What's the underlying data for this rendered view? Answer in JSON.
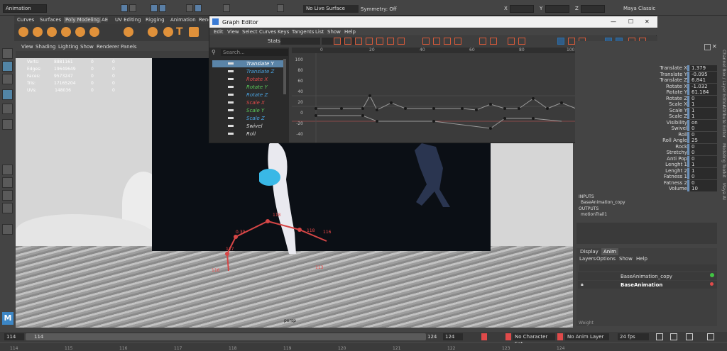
{
  "topbar": {
    "mode_select": "Animation",
    "live_surface": "No Live Surface",
    "symmetry": "Symmetry: Off",
    "axes": [
      "X",
      "Y",
      "Z"
    ],
    "workspace": "Maya Classic"
  },
  "shelf": {
    "tabs": [
      "Curves",
      "Surfaces",
      "Poly Modeling",
      "AE",
      "UV Editing",
      "Rigging",
      "Animation",
      "Rend"
    ],
    "active_tab": "Poly Modeling"
  },
  "viewport": {
    "menu": [
      "View",
      "Shading",
      "Lighting",
      "Show",
      "Renderer",
      "Panels"
    ],
    "hud": [
      {
        "label": "Verts:",
        "v1": "8881161",
        "v2": "0",
        "v3": "0"
      },
      {
        "label": "Edges:",
        "v1": "19649649",
        "v2": "0",
        "v3": "0"
      },
      {
        "label": "Faces:",
        "v1": "9573247",
        "v2": "0",
        "v3": "0"
      },
      {
        "label": "Tris:",
        "v1": "17165204",
        "v2": "0",
        "v3": "0"
      },
      {
        "label": "UVs:",
        "v1": "148036",
        "v2": "0",
        "v3": "0"
      }
    ],
    "camera_label": "persp",
    "rig_labels": [
      "0.39",
      "118",
      "117",
      "116",
      "118",
      "113",
      "116"
    ]
  },
  "graph_editor": {
    "title": "Graph Editor",
    "window_controls": [
      "—",
      "☐",
      "✕"
    ],
    "menu": [
      "Edit",
      "View",
      "Select",
      "Curves",
      "Keys",
      "Tangents",
      "List",
      "Show",
      "Help"
    ],
    "stats_label": "Stats",
    "search_placeholder": "Search...",
    "outliner": [
      {
        "label": "Translate Y",
        "color": "#ffffff",
        "selected": true
      },
      {
        "label": "Translate Z",
        "color": "#4aa3e0",
        "selected": false
      },
      {
        "label": "Rotate X",
        "color": "#e04a4a",
        "selected": false
      },
      {
        "label": "Rotate Y",
        "color": "#5ac95a",
        "selected": false
      },
      {
        "label": "Rotate Z",
        "color": "#4aa3e0",
        "selected": false
      },
      {
        "label": "Scale X",
        "color": "#e04a4a",
        "selected": false
      },
      {
        "label": "Scale Y",
        "color": "#5ac95a",
        "selected": false
      },
      {
        "label": "Scale Z",
        "color": "#4aa3e0",
        "selected": false
      },
      {
        "label": "Swivel",
        "color": "#dddddd",
        "selected": false
      },
      {
        "label": "Roll",
        "color": "#dddddd",
        "selected": false
      }
    ],
    "ruler": [
      "0",
      "20",
      "40",
      "60",
      "80",
      "100"
    ],
    "frame_markers": [
      "114",
      "122",
      "124"
    ],
    "y_ticks": [
      "100",
      "80",
      "60",
      "40",
      "20",
      "0",
      "-20",
      "-40"
    ]
  },
  "channel_box": {
    "channels": [
      {
        "label": "Translate X",
        "value": "1.379"
      },
      {
        "label": "Translate Y",
        "value": "-0.095"
      },
      {
        "label": "Translate Z",
        "value": "6.841"
      },
      {
        "label": "Rotate X",
        "value": "-1.032"
      },
      {
        "label": "Rotate Y",
        "value": "61.184"
      },
      {
        "label": "Rotate Z",
        "value": "0"
      },
      {
        "label": "Scale X",
        "value": "1"
      },
      {
        "label": "Scale Y",
        "value": "1"
      },
      {
        "label": "Scale Z",
        "value": "1"
      },
      {
        "label": "Visibility",
        "value": "on"
      },
      {
        "label": "Swivel",
        "value": "0"
      },
      {
        "label": "Roll",
        "value": "0"
      },
      {
        "label": "Roll Angle",
        "value": "25"
      },
      {
        "label": "Rock",
        "value": "0"
      },
      {
        "label": "Stretchy",
        "value": "0"
      },
      {
        "label": "Anti Pop",
        "value": "0"
      },
      {
        "label": "Lenght 1",
        "value": "1"
      },
      {
        "label": "Lenght 2",
        "value": "1"
      },
      {
        "label": "Fatness 1",
        "value": "0"
      },
      {
        "label": "Fatness 2",
        "value": "0"
      },
      {
        "label": "Volume",
        "value": "10"
      }
    ],
    "inputs_header": "INPUTS",
    "input_item": "BaseAnimation_copy",
    "outputs_header": "OUTPUTS",
    "output_item": "motionTrail1",
    "side_tabs": [
      "Channel Box / Layer Editor",
      "Attribute Editor",
      "Modeling Toolkit",
      "Maya AI"
    ]
  },
  "layer_editor": {
    "tabs": [
      "Display",
      "Anim"
    ],
    "active_tab": "Anim",
    "menu": [
      "Layers",
      "Options",
      "Show",
      "Help"
    ],
    "layers": [
      {
        "name": "BaseAnimation_copy",
        "dot": "#41c443"
      },
      {
        "name": "BaseAnimation",
        "dot": "#e04a4a"
      }
    ],
    "weight_label": "Weight"
  },
  "timeline": {
    "start": "114",
    "start_inner": "114",
    "end_inner": "124",
    "end": "124",
    "character_set": "No Character Set",
    "anim_layer": "No Anim Layer",
    "fps": "24 fps",
    "ticks": [
      "114",
      "115",
      "116",
      "117",
      "118",
      "119",
      "120",
      "121",
      "122",
      "123",
      "124"
    ]
  }
}
